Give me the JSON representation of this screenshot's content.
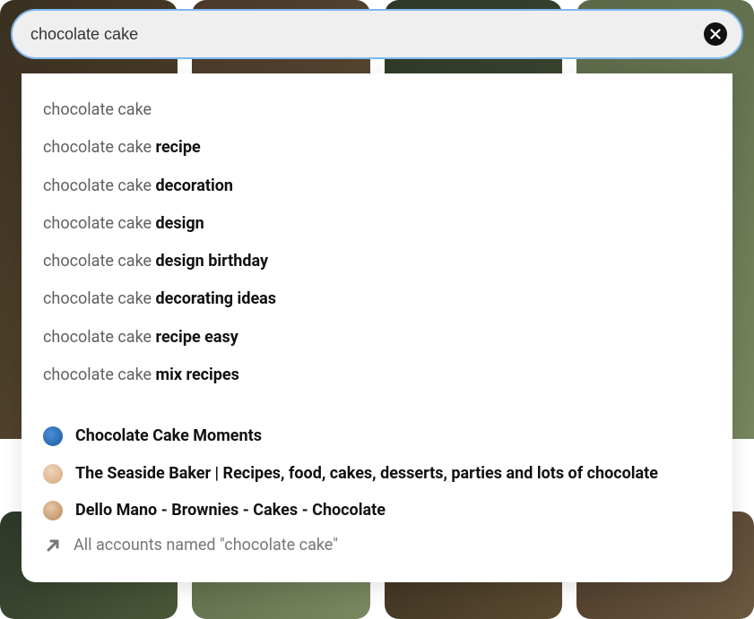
{
  "search": {
    "value": "chocolate cake",
    "placeholder": "Search"
  },
  "suggestions": [
    {
      "prefix": "chocolate cake",
      "suffix": ""
    },
    {
      "prefix": "chocolate cake ",
      "suffix": "recipe"
    },
    {
      "prefix": "chocolate cake ",
      "suffix": "decoration"
    },
    {
      "prefix": "chocolate cake ",
      "suffix": "design"
    },
    {
      "prefix": "chocolate cake ",
      "suffix": "design birthday"
    },
    {
      "prefix": "chocolate cake ",
      "suffix": "decorating ideas"
    },
    {
      "prefix": "chocolate cake ",
      "suffix": "recipe easy"
    },
    {
      "prefix": "chocolate cake ",
      "suffix": "mix recipes"
    }
  ],
  "accounts": [
    {
      "name": "Chocolate Cake Moments"
    },
    {
      "name": "The Seaside Baker | Recipes, food, cakes, desserts, parties and lots of chocolate"
    },
    {
      "name": "Dello Mano - Brownies - Cakes - Chocolate"
    }
  ],
  "all_accounts_label": "All accounts named \"chocolate cake\""
}
